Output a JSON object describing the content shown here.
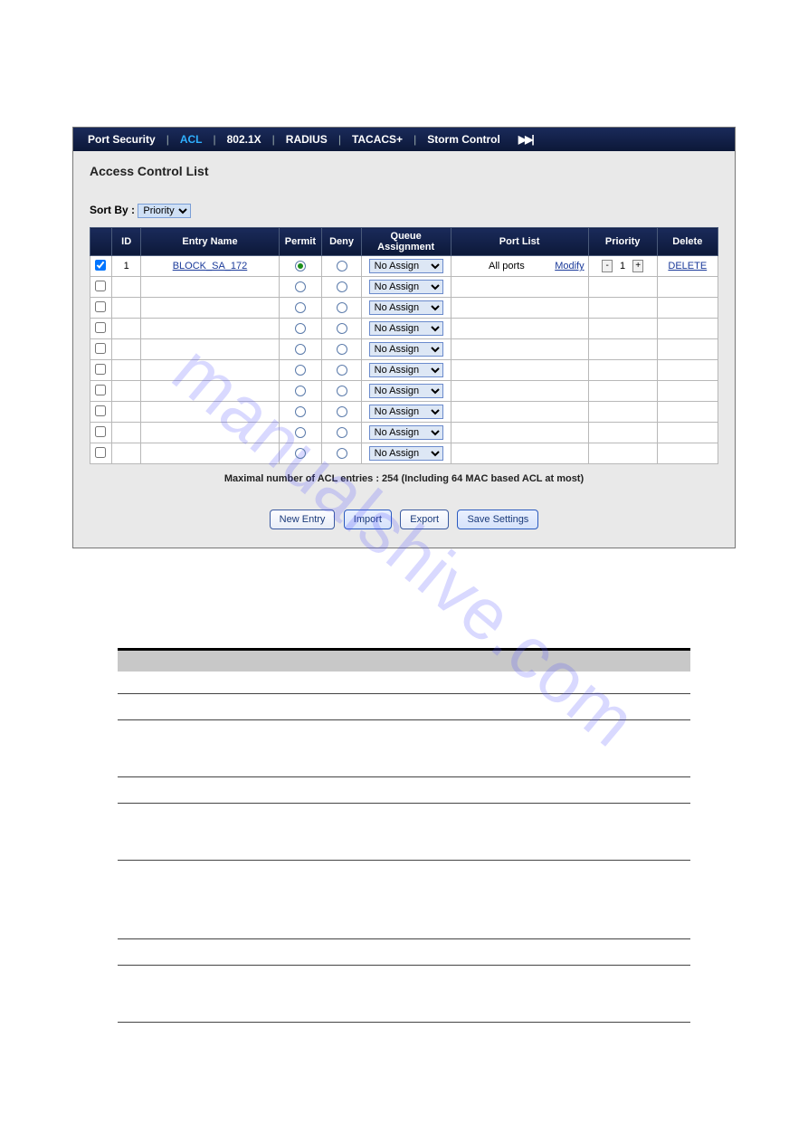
{
  "watermark": "manualshive.com",
  "navbar": {
    "items": [
      {
        "label": "Port Security",
        "active": false
      },
      {
        "label": "ACL",
        "active": true
      },
      {
        "label": "802.1X",
        "active": false
      },
      {
        "label": "RADIUS",
        "active": false
      },
      {
        "label": "TACACS+",
        "active": false
      },
      {
        "label": "Storm Control",
        "active": false
      }
    ]
  },
  "page_title": "Access Control List",
  "sort_by": {
    "label": "Sort By :",
    "value": "Priority",
    "options": [
      "Priority"
    ]
  },
  "table": {
    "headers": {
      "check": "",
      "id": "ID",
      "entry_name": "Entry Name",
      "permit": "Permit",
      "deny": "Deny",
      "queue": "Queue Assignment",
      "port_list": "Port List",
      "priority": "Priority",
      "delete": "Delete"
    },
    "queue_options": [
      "No Assign"
    ],
    "rows": [
      {
        "checked": true,
        "id": "1",
        "entry_name": "BLOCK_SA_172",
        "permit": true,
        "deny": false,
        "queue": "No Assign",
        "port_list": "All ports",
        "modify_label": "Modify",
        "priority": "1",
        "delete_label": "DELETE"
      },
      {
        "checked": false,
        "id": "",
        "entry_name": "",
        "permit": false,
        "deny": false,
        "queue": "No Assign",
        "port_list": "",
        "modify_label": "",
        "priority": "",
        "delete_label": ""
      },
      {
        "checked": false,
        "id": "",
        "entry_name": "",
        "permit": false,
        "deny": false,
        "queue": "No Assign",
        "port_list": "",
        "modify_label": "",
        "priority": "",
        "delete_label": ""
      },
      {
        "checked": false,
        "id": "",
        "entry_name": "",
        "permit": false,
        "deny": false,
        "queue": "No Assign",
        "port_list": "",
        "modify_label": "",
        "priority": "",
        "delete_label": ""
      },
      {
        "checked": false,
        "id": "",
        "entry_name": "",
        "permit": false,
        "deny": false,
        "queue": "No Assign",
        "port_list": "",
        "modify_label": "",
        "priority": "",
        "delete_label": ""
      },
      {
        "checked": false,
        "id": "",
        "entry_name": "",
        "permit": false,
        "deny": false,
        "queue": "No Assign",
        "port_list": "",
        "modify_label": "",
        "priority": "",
        "delete_label": ""
      },
      {
        "checked": false,
        "id": "",
        "entry_name": "",
        "permit": false,
        "deny": false,
        "queue": "No Assign",
        "port_list": "",
        "modify_label": "",
        "priority": "",
        "delete_label": ""
      },
      {
        "checked": false,
        "id": "",
        "entry_name": "",
        "permit": false,
        "deny": false,
        "queue": "No Assign",
        "port_list": "",
        "modify_label": "",
        "priority": "",
        "delete_label": ""
      },
      {
        "checked": false,
        "id": "",
        "entry_name": "",
        "permit": false,
        "deny": false,
        "queue": "No Assign",
        "port_list": "",
        "modify_label": "",
        "priority": "",
        "delete_label": ""
      },
      {
        "checked": false,
        "id": "",
        "entry_name": "",
        "permit": false,
        "deny": false,
        "queue": "No Assign",
        "port_list": "",
        "modify_label": "",
        "priority": "",
        "delete_label": ""
      }
    ]
  },
  "footnote": "Maximal number of ACL entries : 254 (Including 64 MAC based ACL at most)",
  "buttons": {
    "new_entry": "New Entry",
    "import": "Import",
    "export": "Export",
    "save": "Save Settings"
  },
  "stepper": {
    "minus": "-",
    "plus": "+"
  }
}
